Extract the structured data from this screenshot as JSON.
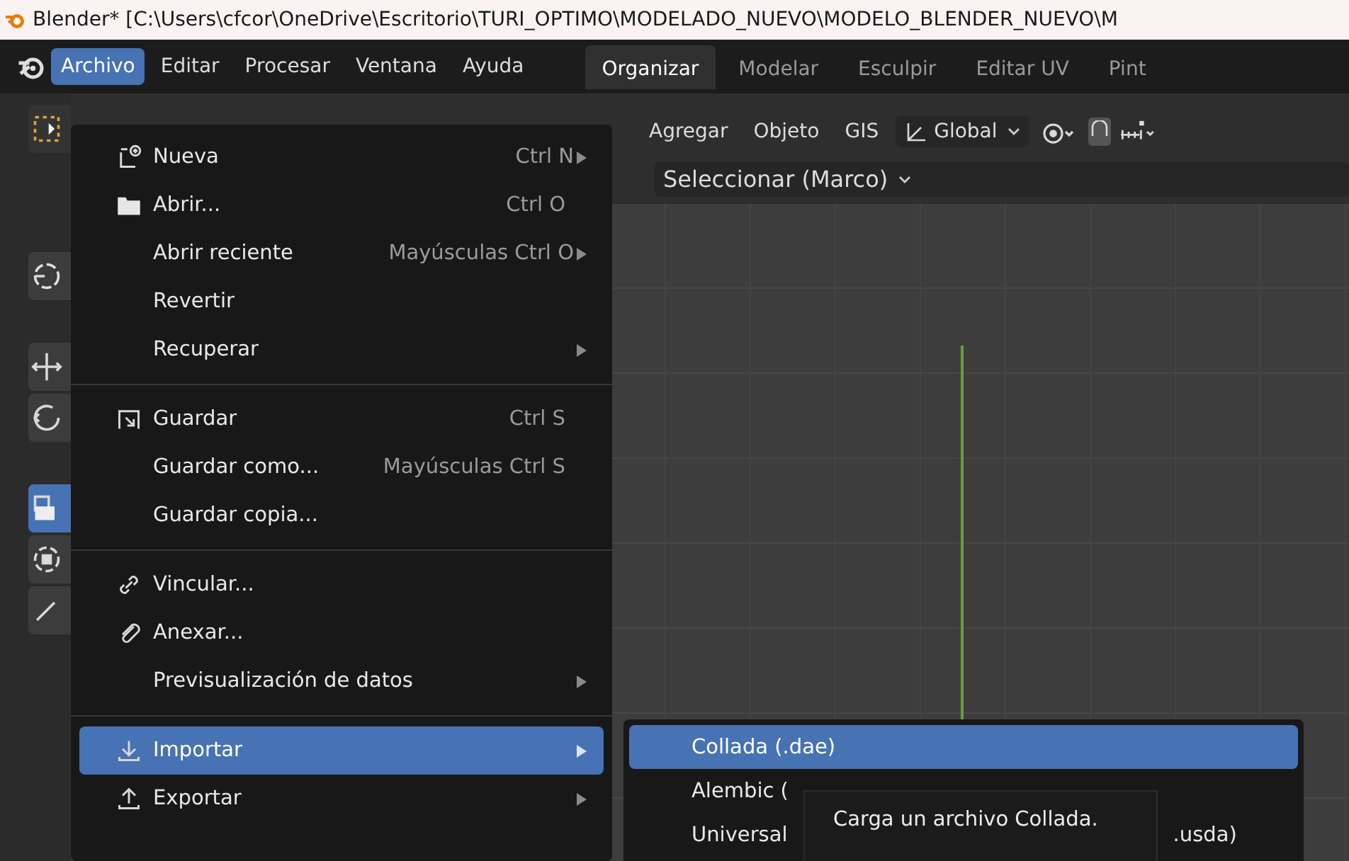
{
  "window": {
    "title": "Blender* [C:\\Users\\cfcor\\OneDrive\\Escritorio\\TURI_OPTIMO\\MODELADO_NUEVO\\MODELO_BLENDER_NUEVO\\M"
  },
  "menu_bar": [
    {
      "label": "Archivo",
      "selected": true
    },
    {
      "label": "Editar",
      "selected": false
    },
    {
      "label": "Procesar",
      "selected": false
    },
    {
      "label": "Ventana",
      "selected": false
    },
    {
      "label": "Ayuda",
      "selected": false
    }
  ],
  "workspaces": [
    {
      "label": "Organizar",
      "selected": true
    },
    {
      "label": "Modelar",
      "selected": false
    },
    {
      "label": "Esculpir",
      "selected": false
    },
    {
      "label": "Editar UV",
      "selected": false
    },
    {
      "label": "Pint",
      "selected": false
    }
  ],
  "toolbar_tools": [
    {
      "selected": false
    },
    {
      "selected": false
    },
    {
      "selected": false
    },
    {
      "selected": false
    },
    {
      "selected": true
    },
    {
      "selected": false
    },
    {
      "selected": false
    }
  ],
  "viewport_header": {
    "menus": [
      "Agregar",
      "Objeto",
      "GIS"
    ],
    "orientation": "Global",
    "select_mode": "Seleccionar (Marco)",
    "snap_on": true
  },
  "file_menu": {
    "sections": [
      [
        {
          "label": "Nueva",
          "shortcut": "Ctrl N",
          "submenu": true,
          "selected": false
        },
        {
          "label": "Abrir...",
          "shortcut": "Ctrl O",
          "submenu": false,
          "selected": false
        },
        {
          "label": "Abrir reciente",
          "shortcut": "Mayúsculas Ctrl O",
          "submenu": true,
          "selected": false
        },
        {
          "label": "Revertir",
          "submenu": false,
          "selected": false
        },
        {
          "label": "Recuperar",
          "submenu": true,
          "selected": false
        }
      ],
      [
        {
          "label": "Guardar",
          "shortcut": "Ctrl S",
          "submenu": false,
          "selected": false
        },
        {
          "label": "Guardar como...",
          "shortcut": "Mayúsculas Ctrl S",
          "submenu": false,
          "selected": false
        },
        {
          "label": "Guardar copia...",
          "submenu": false,
          "selected": false
        }
      ],
      [
        {
          "label": "Vincular...",
          "submenu": false,
          "selected": false
        },
        {
          "label": "Anexar...",
          "submenu": false,
          "selected": false
        },
        {
          "label": "Previsualización de datos",
          "submenu": true,
          "selected": false
        }
      ],
      [
        {
          "label": "Importar",
          "submenu": true,
          "selected": true
        },
        {
          "label": "Exportar",
          "submenu": true,
          "selected": false
        }
      ]
    ]
  },
  "import_submenu": [
    {
      "label": "Collada (.dae)",
      "selected": true
    },
    {
      "label": "Alembic (",
      "selected": false
    },
    {
      "label": "Universal",
      "tail": ".usda)",
      "selected": false
    }
  ],
  "tooltip": "Carga un archivo Collada."
}
